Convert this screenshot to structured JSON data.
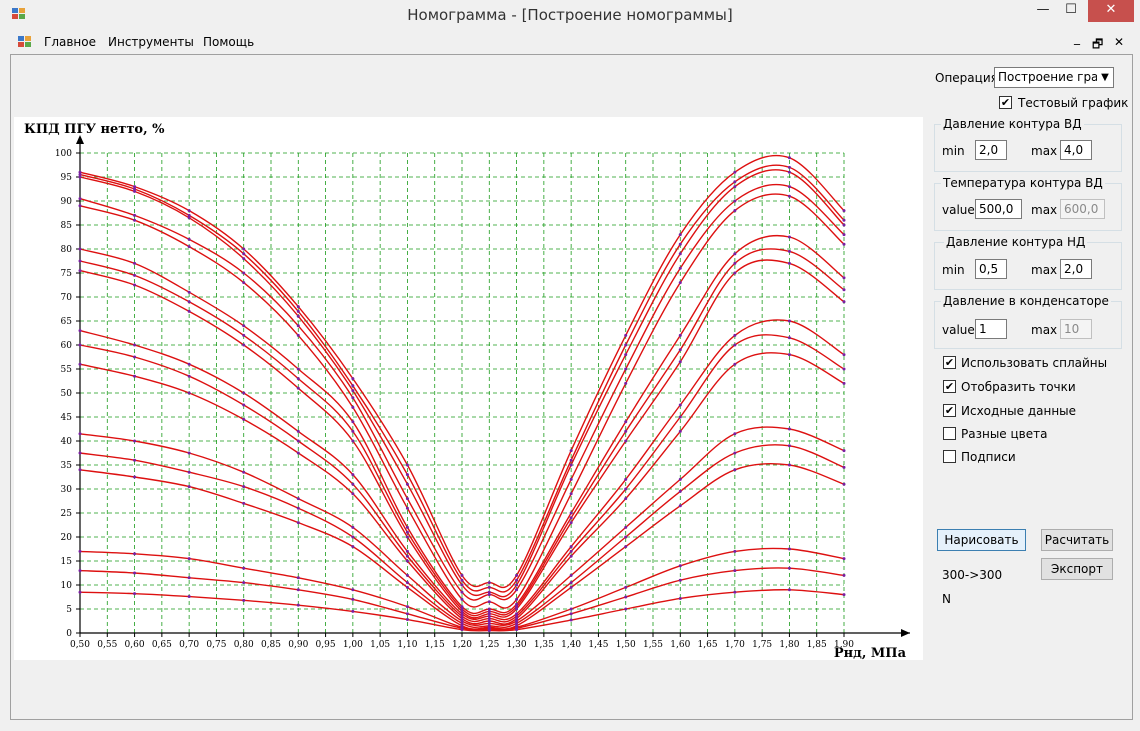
{
  "window": {
    "title": "Номограмма - [Построение номограммы]",
    "controls": {
      "minimize": "—",
      "maximize": "☐",
      "close": "✕"
    }
  },
  "menu": {
    "items": [
      "Главное",
      "Инструменты",
      "Помощь"
    ]
  },
  "mdi_controls": {
    "minimize": "_",
    "restore": "🗗",
    "close": "✕"
  },
  "panel": {
    "operation_label": "Операция",
    "operation_value": "Построение график",
    "test_graph_label": "Тестовый график",
    "test_graph_checked": true,
    "hp_pressure": {
      "title": "Давление контура ВД",
      "min_label": "min",
      "min_value": "2,0",
      "max_label": "max",
      "max_value": "4,0"
    },
    "hp_temperature": {
      "title": "Температура контура ВД",
      "value_label": "value",
      "value": "500,0",
      "max_label": "max",
      "max_value": "600,0"
    },
    "lp_pressure": {
      "title": "Давление контура НД",
      "min_label": "min",
      "min_value": "0,5",
      "max_label": "max",
      "max_value": "2,0"
    },
    "condenser_pressure": {
      "title": "Давление в конденсаторе",
      "value_label": "value",
      "value": "1",
      "max_label": "max",
      "max_value": "10"
    },
    "checkboxes": [
      {
        "label": "Использовать сплайны",
        "checked": true
      },
      {
        "label": "Отобразить точки",
        "checked": true
      },
      {
        "label": "Исходные данные",
        "checked": true
      },
      {
        "label": "Разные цвета",
        "checked": false
      },
      {
        "label": "Подписи",
        "checked": false
      }
    ],
    "draw_button": "Нарисовать",
    "calc_button": "Расчитать",
    "export_button": "Экспорт",
    "status_text": "300->300",
    "status_text2": "N"
  },
  "chart_data": {
    "type": "line",
    "ylabel": "КПД ПГУ нетто, %",
    "xlabel": "Pнд, МПа",
    "xlim": [
      0.5,
      1.9
    ],
    "ylim": [
      0,
      100
    ],
    "x_ticks": [
      "0,50",
      "0,55",
      "0,60",
      "0,65",
      "0,70",
      "0,75",
      "0,80",
      "0,85",
      "0,90",
      "0,95",
      "1,00",
      "1,05",
      "1,10",
      "1,15",
      "1,20",
      "1,25",
      "1,30",
      "1,35",
      "1,40",
      "1,45",
      "1,50",
      "1,55",
      "1,60",
      "1,65",
      "1,70",
      "1,75",
      "1,80",
      "1,85",
      "1,90"
    ],
    "y_ticks": [
      "0",
      "5",
      "10",
      "15",
      "20",
      "25",
      "30",
      "35",
      "40",
      "45",
      "50",
      "55",
      "60",
      "65",
      "70",
      "75",
      "80",
      "85",
      "90",
      "95",
      "100"
    ],
    "grid": true,
    "line_color": "#dd1010",
    "point_color": "#7a1fa2",
    "grid_color": "#1a9a1a",
    "x": [
      0.5,
      0.6,
      0.7,
      0.8,
      0.9,
      1.0,
      1.1,
      1.2,
      1.25,
      1.3,
      1.4,
      1.5,
      1.6,
      1.7,
      1.8,
      1.9
    ],
    "series": [
      {
        "values": [
          96,
          93,
          88,
          80,
          68,
          53,
          35,
          12,
          10.5,
          12,
          38,
          62,
          83,
          96,
          99,
          88
        ]
      },
      {
        "values": [
          95.5,
          92.5,
          87,
          79,
          67,
          51.5,
          33,
          11,
          9.5,
          11,
          36,
          60,
          81,
          94,
          97,
          86
        ]
      },
      {
        "values": [
          95,
          92,
          86.5,
          78,
          66,
          50.5,
          31,
          10,
          8.5,
          10,
          35,
          58,
          79,
          93,
          96,
          85
        ]
      },
      {
        "values": [
          90.5,
          87,
          82,
          75,
          64,
          49,
          28,
          8.5,
          8,
          9,
          32,
          55,
          76,
          90,
          93,
          83
        ]
      },
      {
        "values": [
          89,
          86,
          80.5,
          73,
          62,
          47,
          26,
          7,
          6.5,
          7,
          29,
          52,
          73,
          88,
          91,
          81
        ]
      },
      {
        "values": [
          80,
          77,
          71,
          64,
          55,
          44,
          22,
          5.5,
          5,
          6,
          25,
          44,
          62,
          79,
          82.5,
          74
        ]
      },
      {
        "values": [
          77.5,
          74.5,
          69,
          62,
          53,
          42,
          21,
          5,
          4.5,
          5.5,
          24,
          42,
          59,
          77,
          79.5,
          71.5
        ]
      },
      {
        "values": [
          75.5,
          72.5,
          67,
          60,
          51,
          40,
          20,
          4.5,
          4,
          5,
          23,
          40,
          56.5,
          75,
          77,
          69
        ]
      },
      {
        "values": [
          63,
          60,
          56,
          50,
          42,
          33,
          17,
          4,
          3.5,
          4,
          18,
          32,
          47.5,
          62,
          65,
          58
        ]
      },
      {
        "values": [
          60,
          57.5,
          53.5,
          47.5,
          40,
          31,
          16,
          3.5,
          3,
          3.5,
          17,
          30,
          45,
          60,
          61.5,
          55
        ]
      },
      {
        "values": [
          56,
          53.5,
          50,
          44.5,
          37.5,
          29,
          15,
          3,
          2.5,
          3,
          16,
          28,
          42,
          56,
          58,
          52
        ]
      },
      {
        "values": [
          41.5,
          40,
          37.5,
          33.5,
          28,
          22,
          12,
          2.5,
          2,
          2.5,
          12,
          22,
          32,
          41.5,
          42.5,
          38
        ]
      },
      {
        "values": [
          37.5,
          36,
          33.5,
          30.5,
          26,
          20,
          10.5,
          2,
          1.5,
          2,
          10.5,
          20,
          29.5,
          37.5,
          39,
          34.5
        ]
      },
      {
        "values": [
          34,
          32.5,
          30.5,
          27,
          23,
          18,
          9.5,
          1.5,
          1.2,
          1.5,
          9.5,
          18,
          26.5,
          34,
          35,
          31
        ]
      },
      {
        "values": [
          17,
          16.5,
          15.5,
          13.5,
          11.5,
          9,
          5.5,
          1.2,
          1,
          1.2,
          5,
          9.5,
          14,
          17,
          17.5,
          15.5
        ]
      },
      {
        "values": [
          13,
          12.5,
          11.5,
          10.5,
          9,
          7,
          4,
          1,
          0.8,
          1,
          4,
          7.5,
          11,
          13,
          13.5,
          12
        ]
      },
      {
        "values": [
          8.5,
          8.2,
          7.6,
          6.8,
          5.8,
          4.5,
          2.8,
          0.7,
          0.5,
          0.7,
          2.7,
          5,
          7.2,
          8.5,
          9,
          8
        ]
      }
    ]
  }
}
